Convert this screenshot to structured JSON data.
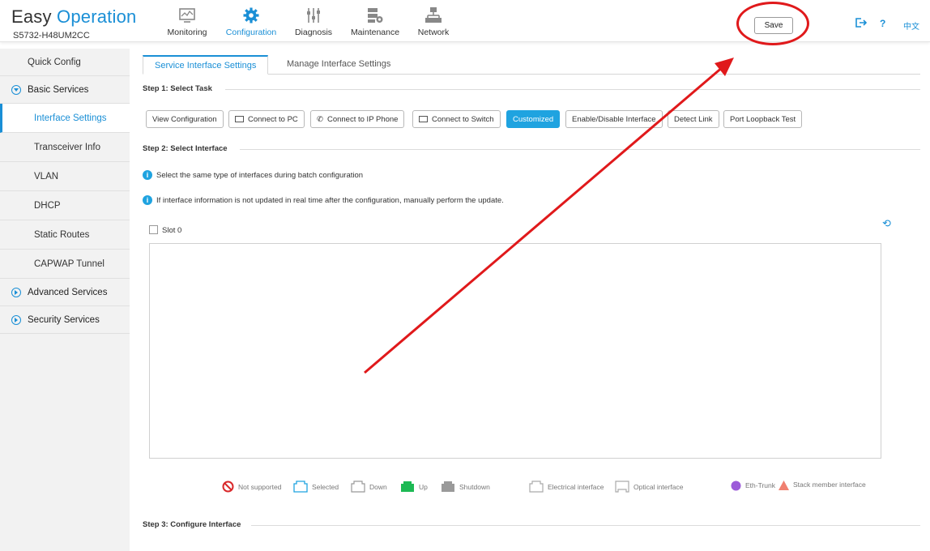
{
  "header": {
    "brand_part1": "Easy",
    "brand_part2": "Operation",
    "model": "S5732-H48UM2CC",
    "nav": [
      {
        "label": "Monitoring",
        "icon": "monitor-icon"
      },
      {
        "label": "Configuration",
        "icon": "gear-icon"
      },
      {
        "label": "Diagnosis",
        "icon": "sliders-icon"
      },
      {
        "label": "Maintenance",
        "icon": "server-gear-icon"
      },
      {
        "label": "Network",
        "icon": "topology-icon"
      }
    ],
    "save_label": "Save",
    "help_label": "?",
    "lang_label": "中文"
  },
  "sidebar": {
    "quick_config": "Quick Config",
    "basic_services": "Basic Services",
    "items": [
      "Interface Settings",
      "Transceiver Info",
      "VLAN",
      "DHCP",
      "Static Routes",
      "CAPWAP Tunnel"
    ],
    "advanced_services": "Advanced Services",
    "security_services": "Security Services"
  },
  "main": {
    "tabs": [
      "Service Interface Settings",
      "Manage Interface Settings"
    ],
    "step1": "Step 1: Select Task",
    "tasks": [
      "View Configuration",
      "Connect to PC",
      "Connect to IP Phone",
      "Connect to Switch",
      "Customized",
      "Enable/Disable Interface",
      "Detect Link",
      "Port Loopback Test"
    ],
    "step2": "Step 2: Select Interface",
    "info1": "Select the same type of interfaces during batch configuration",
    "info2": "If interface information is not updated in real time after the configuration, manually perform the update.",
    "slot": "Slot 0",
    "legend": [
      "Not supported",
      "Selected",
      "Down",
      "Up",
      "Shutdown",
      "Electrical interface",
      "Optical interface",
      "Eth-Trunk",
      "Stack member interface"
    ],
    "step3": "Step 3: Configure Interface"
  },
  "colors": {
    "accent": "#1a8fd6",
    "active_button": "#1fa3e0",
    "annotation_red": "#e0191b",
    "up_green": "#1db954",
    "shutdown_gray": "#9a9a9a"
  }
}
